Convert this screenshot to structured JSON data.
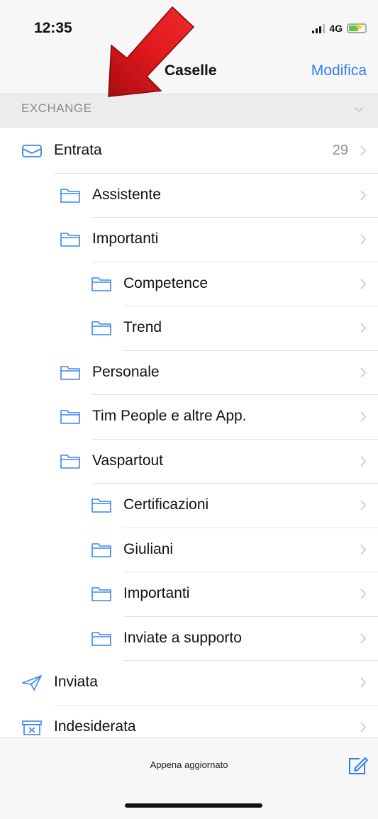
{
  "status": {
    "time": "12:35",
    "network": "4G"
  },
  "nav": {
    "title": "Caselle",
    "edit_label": "Modifica"
  },
  "section": {
    "label": "EXCHANGE"
  },
  "mailboxes": [
    {
      "label": "Entrata",
      "count": "29",
      "icon": "inbox-icon",
      "level": 0
    },
    {
      "label": "Assistente",
      "count": "",
      "icon": "folder-icon",
      "level": 1
    },
    {
      "label": "Importanti",
      "count": "",
      "icon": "folder-icon",
      "level": 1
    },
    {
      "label": "Competence",
      "count": "",
      "icon": "folder-icon",
      "level": 2
    },
    {
      "label": "Trend",
      "count": "",
      "icon": "folder-icon",
      "level": 2
    },
    {
      "label": "Personale",
      "count": "",
      "icon": "folder-icon",
      "level": 1
    },
    {
      "label": "Tim People e altre App.",
      "count": "",
      "icon": "folder-icon",
      "level": 1
    },
    {
      "label": "Vaspartout",
      "count": "",
      "icon": "folder-icon",
      "level": 1
    },
    {
      "label": "Certificazioni",
      "count": "",
      "icon": "folder-icon",
      "level": 2
    },
    {
      "label": "Giuliani",
      "count": "",
      "icon": "folder-icon",
      "level": 2
    },
    {
      "label": "Importanti",
      "count": "",
      "icon": "folder-icon",
      "level": 2
    },
    {
      "label": "Inviate a supporto",
      "count": "",
      "icon": "folder-icon",
      "level": 2
    },
    {
      "label": "Inviata",
      "count": "",
      "icon": "sent-icon",
      "level": 0
    },
    {
      "label": "Indesiderata",
      "count": "",
      "icon": "junk-icon",
      "level": 0
    }
  ],
  "toolbar": {
    "status": "Appena aggiornato"
  },
  "colors": {
    "accent": "#2f7ff3",
    "arrow": "#d0161a"
  }
}
